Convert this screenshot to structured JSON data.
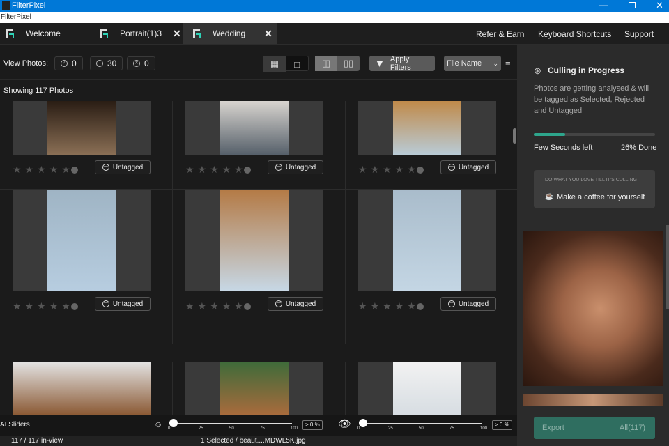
{
  "window": {
    "title": "FilterPixel",
    "menu": "FilterPixel",
    "controls": [
      "minimize",
      "maximize",
      "close"
    ]
  },
  "tabs": [
    {
      "label": "Welcome",
      "closable": false
    },
    {
      "label": "Portrait(1)3",
      "closable": true
    },
    {
      "label": "Wedding",
      "closable": true,
      "active": true
    }
  ],
  "nav": {
    "refer": "Refer & Earn",
    "shortcuts": "Keyboard Shortcuts",
    "support": "Support"
  },
  "toolbar": {
    "view_label": "View Photos:",
    "selected_count": "0",
    "untagged_count": "30",
    "rejected_count": "0",
    "apply_filters": "Apply Filters",
    "sort": "File Name"
  },
  "showing": "Showing 117 Photos",
  "photos": [
    {
      "tag": "Untagged",
      "rating": 0,
      "colors": [
        "#2a1d14",
        "#8a6f55"
      ],
      "orientation": "portrait"
    },
    {
      "tag": "Untagged",
      "rating": 0,
      "colors": [
        "#d8d4cf",
        "#56606a"
      ],
      "orientation": "portrait"
    },
    {
      "tag": "Untagged",
      "rating": 0,
      "colors": [
        "#c08a4a",
        "#b9cbd6"
      ],
      "orientation": "portrait"
    },
    {
      "tag": "Untagged",
      "rating": 0,
      "colors": [
        "#9fb4c4",
        "#b7cde0"
      ],
      "orientation": "portrait"
    },
    {
      "tag": "Untagged",
      "rating": 0,
      "colors": [
        "#b47a45",
        "#c7d8e6"
      ],
      "orientation": "portrait"
    },
    {
      "tag": "Untagged",
      "rating": 0,
      "colors": [
        "#a9bccb",
        "#c4d6e4"
      ],
      "orientation": "portrait"
    },
    {
      "tag": "",
      "rating": 0,
      "colors": [
        "#e4e4e4",
        "#8b5a35"
      ],
      "orientation": "landscape"
    },
    {
      "tag": "",
      "rating": 0,
      "colors": [
        "#3e6b3a",
        "#a86b3c"
      ],
      "orientation": "portrait"
    },
    {
      "tag": "",
      "rating": 0,
      "colors": [
        "#f2f2f2",
        "#d7dde2"
      ],
      "orientation": "portrait"
    }
  ],
  "sidebar": {
    "title": "Culling in Progress",
    "desc": "Photos are getting analysed & will be tagged as Selected, Rejected and Untagged",
    "progress": 26,
    "time_left": "Few Seconds left",
    "done": "26% Done",
    "tip_heading": "DO WHAT YOU LOVE TILL IT'S CULLING",
    "tip": "Make a coffee for yourself",
    "export": "Export",
    "export_scope": "All(117)",
    "accent": "#2ea58c"
  },
  "sliders": {
    "label": "AI Sliders",
    "ticks": [
      "0",
      "25",
      "50",
      "75",
      "100"
    ],
    "face_value": 0,
    "face_pct": "> 0 %",
    "eye_value": 0,
    "eye_pct": "> 0 %"
  },
  "status": {
    "in_view": "117 / 117 in-view",
    "selection": "1 Selected / beaut....MDWL5K.jpg"
  }
}
